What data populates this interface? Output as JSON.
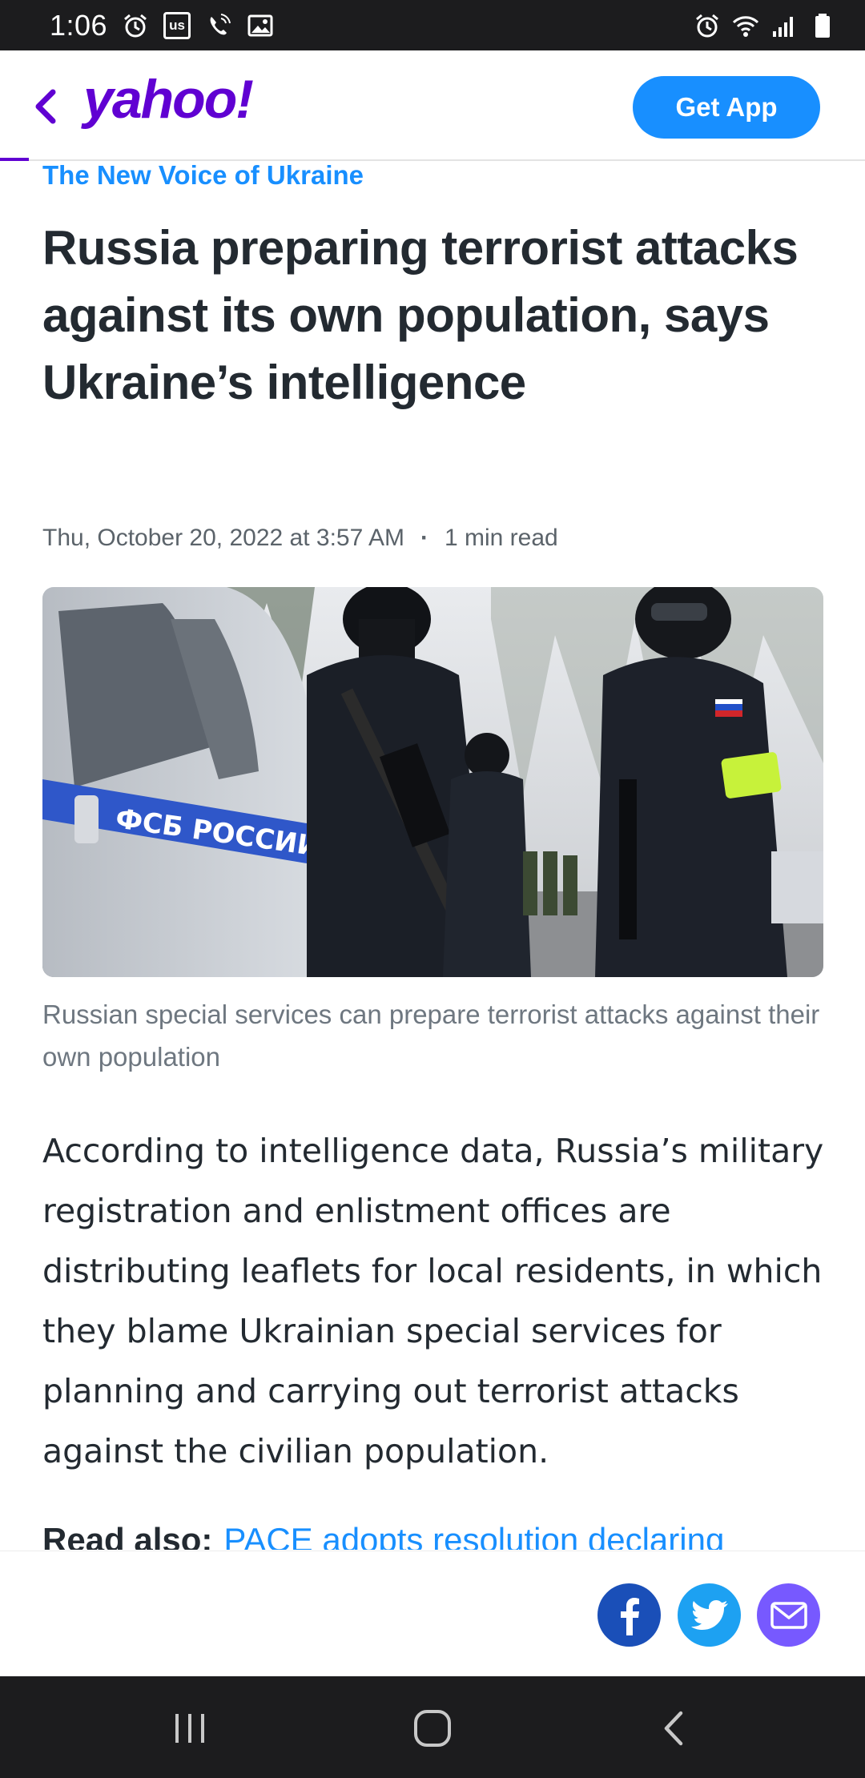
{
  "status_bar": {
    "time": "1:06",
    "left_icons": [
      "alarm-icon",
      "us-badge-icon",
      "wifi-call-icon",
      "gallery-icon"
    ],
    "us_badge": "us",
    "right_icons": [
      "alarm-icon",
      "wifi-icon",
      "signal-icon",
      "battery-icon"
    ]
  },
  "header": {
    "logo": "yahoo!",
    "get_app_label": "Get App",
    "brand_color": "#6001d2",
    "accent_color": "#188fff"
  },
  "article": {
    "provider": "The New Voice of Ukraine",
    "headline": "Russia preparing terrorist attacks against its own population, says Ukraine’s intelligence",
    "date": "Thu, October 20, 2022 at 3:57 AM",
    "separator": "·",
    "read_time": "1 min read",
    "image_van_text": "ФСБ РОССИИ",
    "caption": "Russian special services can prepare terrorist attacks against their own population",
    "body": "According to intelligence data, Russia’s military registration and enlistment offices are distributing leaflets for local residents, in which they blame Ukrainian special services for planning and carrying out terrorist attacks against the civilian population.",
    "read_also_label": "Read also:",
    "read_also_link": "PACE adopts resolution declaring"
  },
  "share": {
    "buttons": [
      "facebook-icon",
      "twitter-icon",
      "mail-icon"
    ],
    "colors": {
      "facebook": "#1a4fb8",
      "twitter": "#1da1f2",
      "mail": "#7759ff"
    }
  },
  "nav_bar": {
    "buttons": [
      "recent-apps-icon",
      "home-icon",
      "back-icon"
    ]
  }
}
